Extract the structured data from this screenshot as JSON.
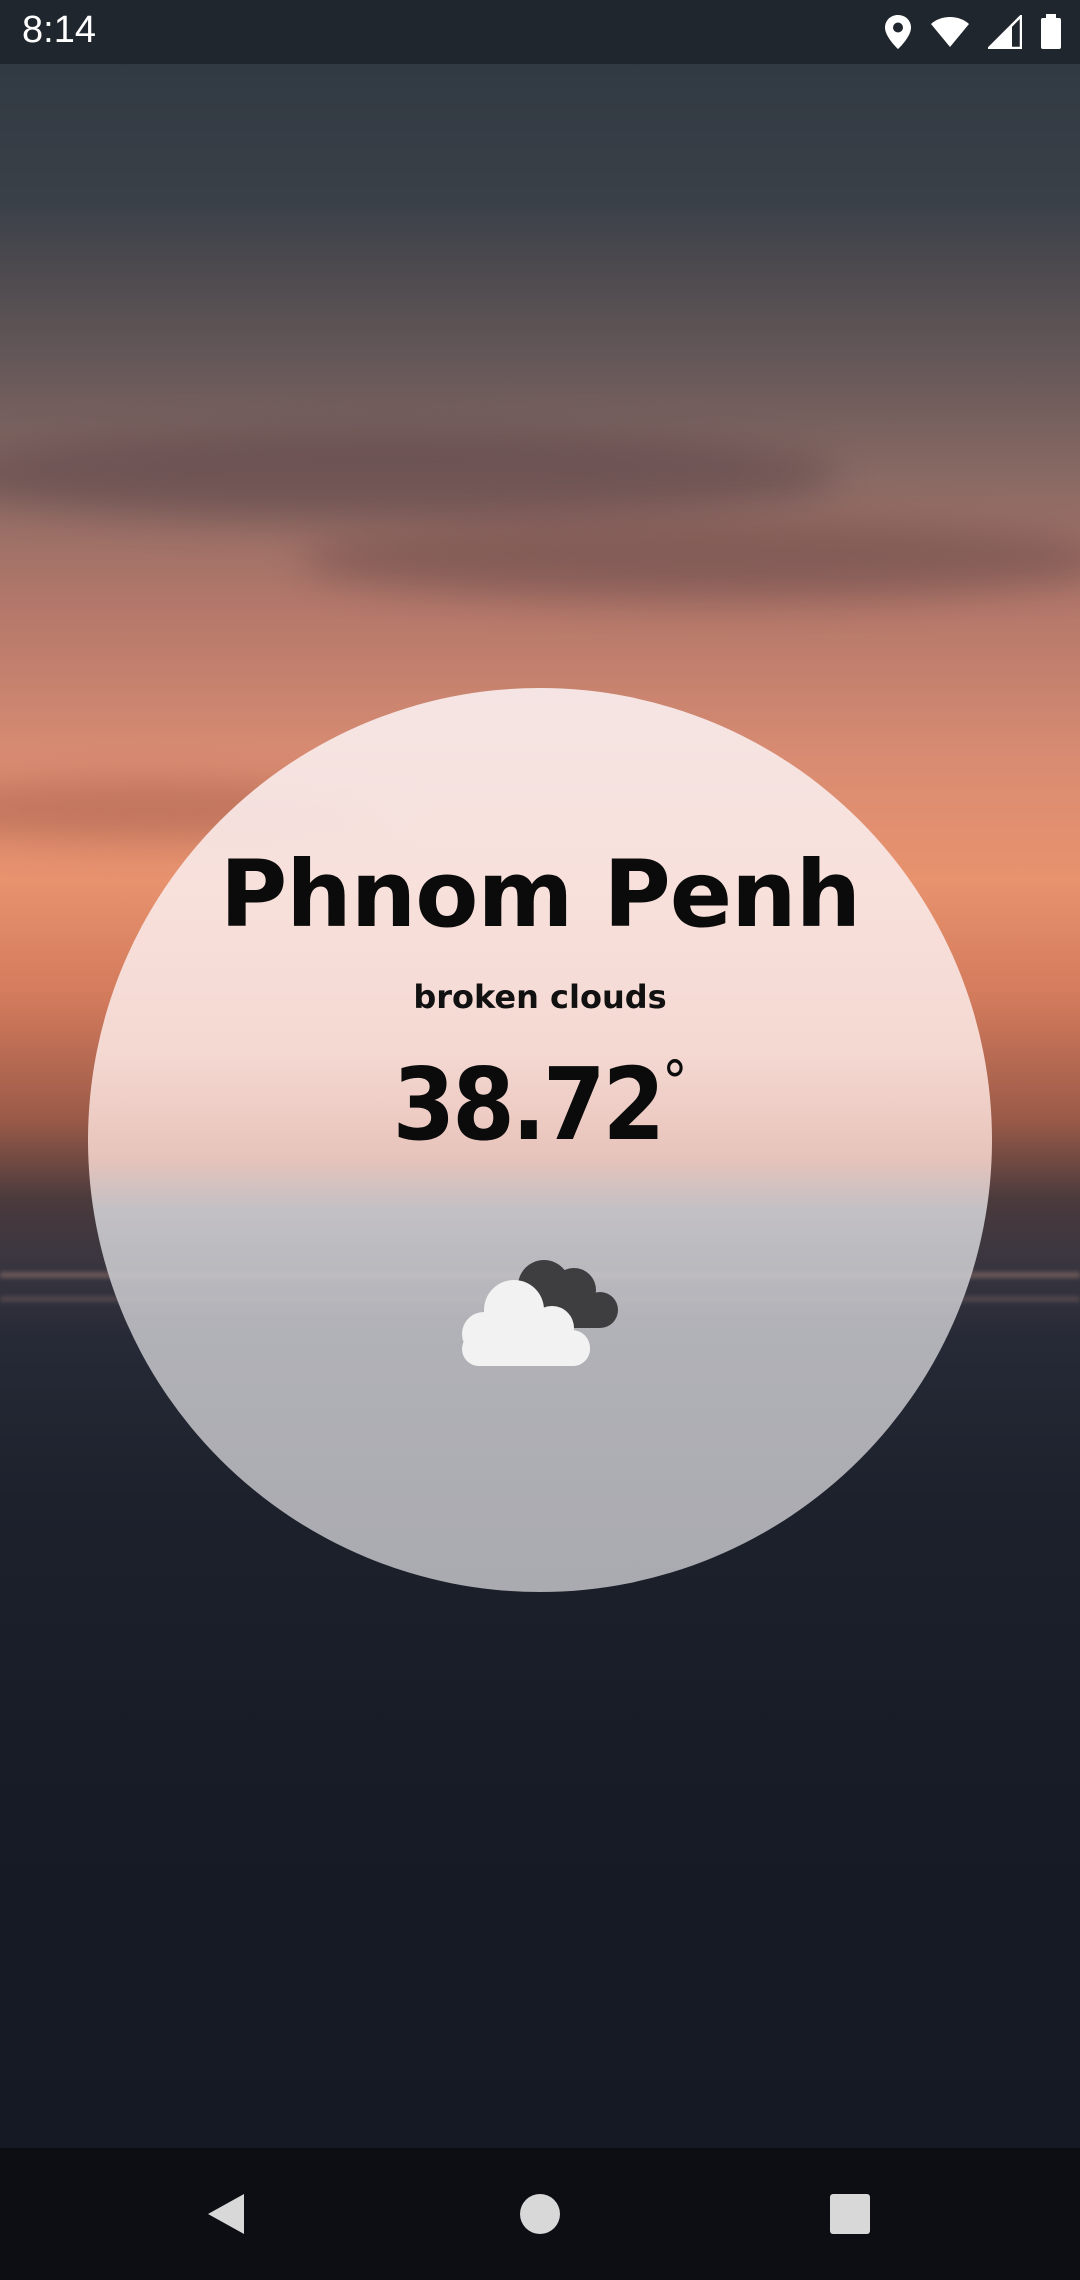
{
  "status_bar": {
    "time": "8:14",
    "icons": [
      "location-icon",
      "wifi-icon",
      "signal-icon",
      "battery-icon"
    ]
  },
  "weather": {
    "city": "Phnom Penh",
    "description": "broken clouds",
    "temperature": "38.72",
    "degree_symbol": "°",
    "icon": "broken-clouds-icon"
  },
  "nav_bar": {
    "buttons": [
      "back-button",
      "home-button",
      "recents-button"
    ]
  },
  "colors": {
    "text": "#0b0b0b",
    "nav_background": "#0c0e14",
    "status_background": "#20262d"
  }
}
